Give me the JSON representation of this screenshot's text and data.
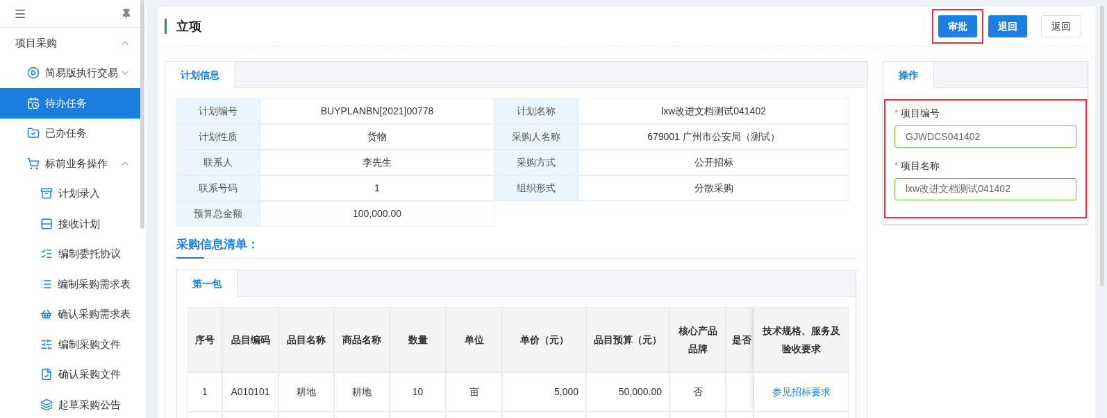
{
  "sidebar": {
    "items": [
      {
        "label": "项目采购",
        "selected": false,
        "expanded": true,
        "children": [
          {
            "label": "简易版执行交易",
            "selected": false,
            "expanded": false
          },
          {
            "label": "待办任务",
            "selected": true
          },
          {
            "label": "已办任务",
            "selected": false
          },
          {
            "label": "标前业务操作",
            "selected": false,
            "expanded": true,
            "children": [
              {
                "label": "计划录入",
                "selected": false
              },
              {
                "label": "接收计划",
                "selected": false
              },
              {
                "label": "编制委托协议",
                "selected": false
              },
              {
                "label": "编制采购需求表",
                "selected": false
              },
              {
                "label": "确认采购需求表",
                "selected": false
              },
              {
                "label": "编制采购文件",
                "selected": false
              },
              {
                "label": "确认采购文件",
                "selected": false
              },
              {
                "label": "起草采购公告",
                "selected": false
              }
            ]
          }
        ]
      }
    ]
  },
  "header": {
    "title": "立项",
    "buttons": [
      {
        "label": "审批",
        "kind": "primary",
        "highlighted": true
      },
      {
        "label": "退回",
        "kind": "primary",
        "highlighted": false
      },
      {
        "label": "返回",
        "kind": "default",
        "highlighted": false
      }
    ]
  },
  "plan_panel": {
    "tabs": [
      {
        "label": "计划信息",
        "selected": true
      }
    ],
    "fields": [
      {
        "label": "计划编号",
        "value": "BUYPLANBN[2021]00778"
      },
      {
        "label": "计划名称",
        "value": "lxw改进文档测试041402"
      },
      {
        "label": "计划性质",
        "value": "货物"
      },
      {
        "label": "采购人名称",
        "value": "679001 广州市公安局（测试）"
      },
      {
        "label": "联系人",
        "value": "李先生"
      },
      {
        "label": "采购方式",
        "value": "公开招标"
      },
      {
        "label": "联系号码",
        "value": "1"
      },
      {
        "label": "组织形式",
        "value": "分散采购"
      },
      {
        "label": "预算总金额",
        "value": "100,000.00"
      }
    ],
    "section_title": "采购信息清单：",
    "package_tabs": [
      {
        "label": "第一包",
        "selected": true
      }
    ],
    "items_table": {
      "columns": [
        "序号",
        "品目编码",
        "品目名称",
        "商品名称",
        "数量",
        "单位",
        "单价（元）",
        "品目预算（元）",
        "核心产品品牌",
        "是否",
        "技术规格、服务及验收要求"
      ],
      "rows": [
        {
          "cells": [
            "1",
            "A010101",
            "耕地",
            "耕地",
            "10",
            "亩",
            "5,000",
            "50,000.00",
            "否"
          ],
          "requirement_link": "参见招标要求"
        }
      ]
    }
  },
  "operation_panel": {
    "tabs": [
      {
        "label": "操作",
        "selected": true
      }
    ],
    "highlighted": true,
    "fields": [
      {
        "label": "项目编号",
        "required_mark": "*",
        "value": "GJWDCS041402"
      },
      {
        "label": "项目名称",
        "required_mark": "*",
        "value": "lxw改进文档测试041402"
      }
    ]
  }
}
